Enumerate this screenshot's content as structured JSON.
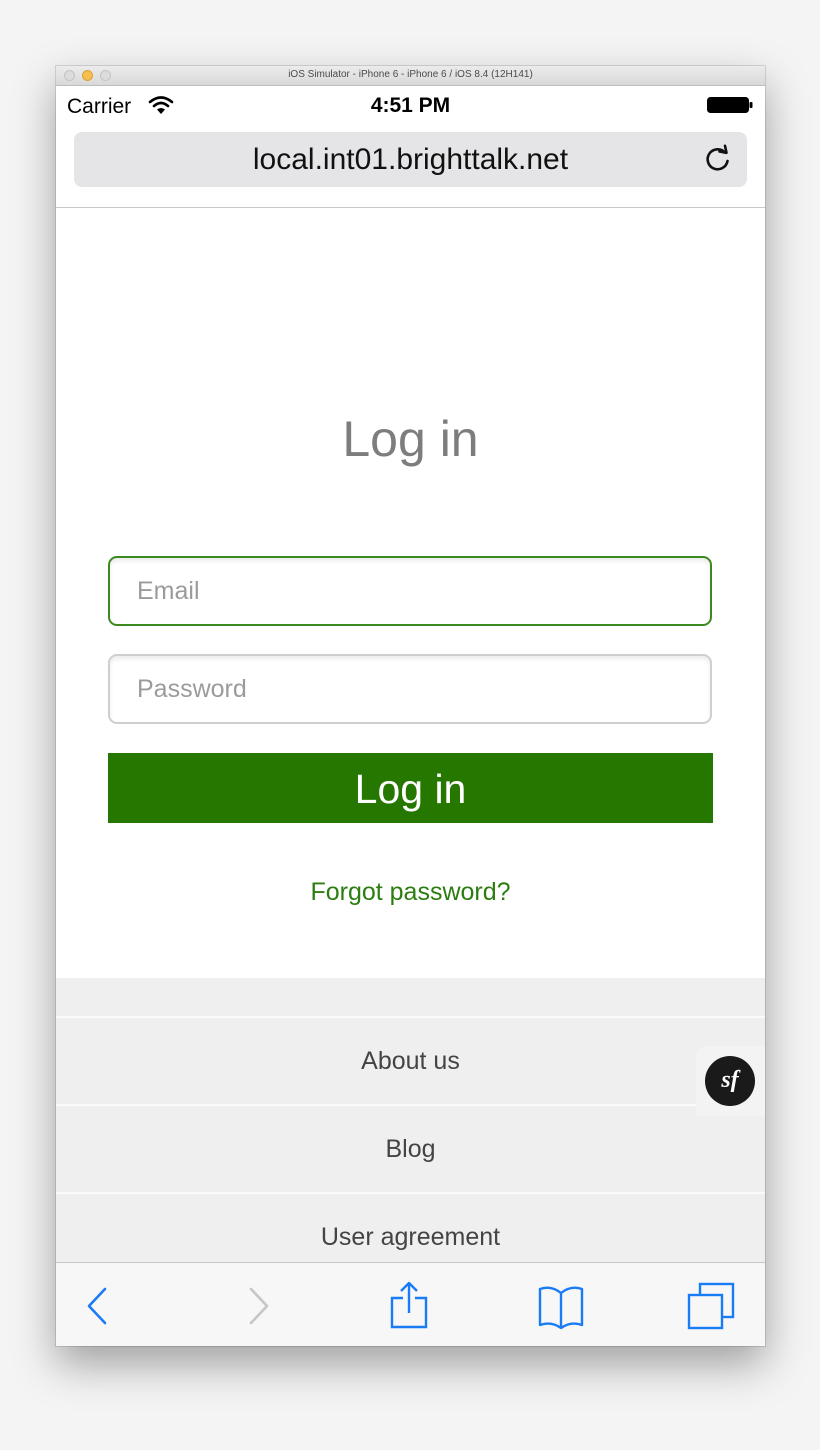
{
  "window": {
    "title": "iOS Simulator - iPhone 6 - iPhone 6 / iOS 8.4 (12H141)"
  },
  "status_bar": {
    "carrier": "Carrier",
    "time": "4:51 PM"
  },
  "address_bar": {
    "url": "local.int01.brighttalk.net"
  },
  "login": {
    "title": "Log in",
    "email_placeholder": "Email",
    "email_value": "",
    "password_placeholder": "Password",
    "password_value": "",
    "submit_label": "Log in",
    "forgot_label": "Forgot password?"
  },
  "footer": {
    "links": [
      "About us",
      "Blog",
      "User agreement"
    ]
  },
  "badge": {
    "text": "sf"
  },
  "toolbar": {
    "icons": [
      "back-icon",
      "forward-icon",
      "share-icon",
      "bookmarks-icon",
      "tabs-icon"
    ]
  },
  "colors": {
    "brand_green": "#267700",
    "link_green": "#2c7d10",
    "ios_blue": "#1a7cf5"
  }
}
